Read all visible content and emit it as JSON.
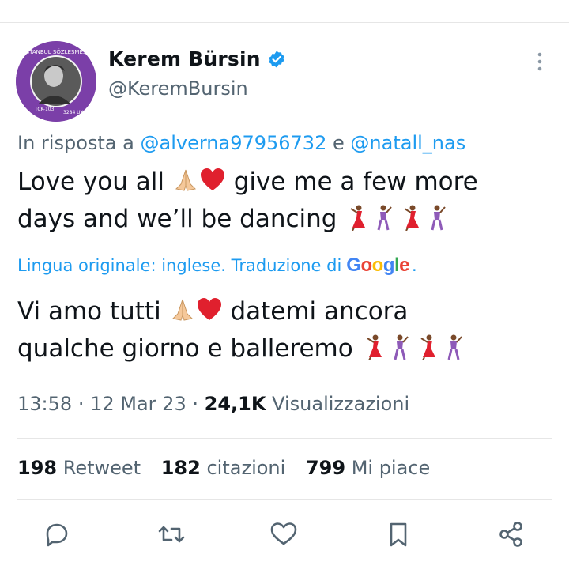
{
  "author": {
    "name": "Kerem Bürsin",
    "handle": "@KeremBursin",
    "avatar_ring_text_top": "İSTANBUL SÖZLEŞMESİ YAŞATIR",
    "avatar_ring_text_bottom_left": "TCK-103",
    "avatar_ring_text_bottom_right": "3284 UYGULA"
  },
  "reply": {
    "prefix": "In risposta a",
    "mention1": "@alverna97956732",
    "conjunction": "e",
    "mention2": "@natall_nas"
  },
  "original_text": {
    "part1": "Love you all",
    "part2": "give me a few more",
    "part3": "days and we’ll be dancing"
  },
  "translation": {
    "note": "Lingua originale: inglese. Traduzione di",
    "brand": "Google",
    "period": "."
  },
  "translated_text": {
    "part1": "Vi amo tutti",
    "part2": "datemi ancora",
    "part3": "qualche giorno e balleremo"
  },
  "meta": {
    "time": "13:58",
    "date": "12 Mar 23",
    "views_count": "24,1K",
    "views_label": "Visualizzazioni"
  },
  "stats": [
    {
      "count": "198",
      "label": "Retweet"
    },
    {
      "count": "182",
      "label": "citazioni"
    },
    {
      "count": "799",
      "label": "Mi piace"
    }
  ],
  "colors": {
    "accent": "#1d9bf0",
    "secondary_text": "#536471",
    "avatar_ring": "#7b3fa8"
  },
  "icons": [
    "verified-badge-icon",
    "more-icon",
    "reply-icon",
    "retweet-icon",
    "like-icon",
    "bookmark-icon",
    "share-icon"
  ]
}
